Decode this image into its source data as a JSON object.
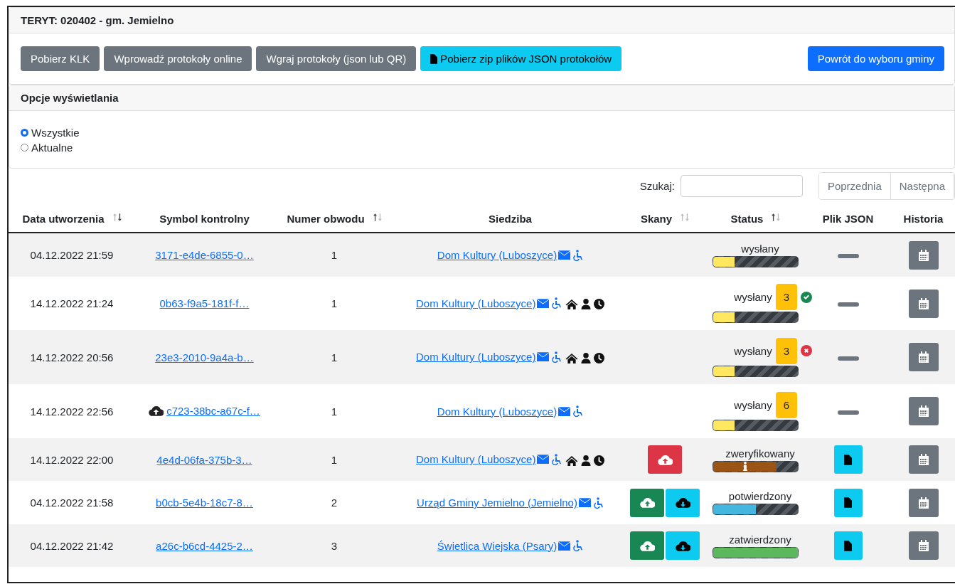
{
  "header": {
    "title": "TERYT: 020402 - gm. Jemielno"
  },
  "toolbar": {
    "buttons": [
      {
        "label": "Pobierz KLK",
        "kind": "secondary"
      },
      {
        "label": "Wprowadź protokoły online",
        "kind": "secondary"
      },
      {
        "label": "Wgraj protokoły (json lub QR)",
        "kind": "secondary"
      },
      {
        "label": "Pobierz zip plików JSON protokołów",
        "kind": "info"
      }
    ],
    "back_button": {
      "label": "Powrót do wyboru gminy"
    }
  },
  "display_options": {
    "title": "Opcje wyświetlania",
    "options": [
      {
        "label": "Wszystkie",
        "selected": true
      },
      {
        "label": "Aktualne",
        "selected": false
      }
    ]
  },
  "search": {
    "label": "Szukaj:"
  },
  "pagination": [
    "Poprzednia",
    "Następna"
  ],
  "table": {
    "columns": [
      {
        "label": "Data utworzenia",
        "sortable": true,
        "sort_asc": false,
        "sort_desc": true
      },
      {
        "label": "Symbol kontrolny",
        "sortable": false
      },
      {
        "label": "Numer obwodu",
        "sortable": true,
        "sort_asc": true,
        "sort_desc": false
      },
      {
        "label": "Siedziba",
        "sortable": false
      },
      {
        "label": "Skany",
        "sortable": true,
        "sort_asc": false,
        "sort_desc": false
      },
      {
        "label": "Status",
        "sortable": true,
        "sort_asc": true,
        "sort_desc": false
      },
      {
        "label": "Plik JSON",
        "sortable": false
      },
      {
        "label": "Historia",
        "sortable": false
      }
    ],
    "rows": [
      {
        "created": "04.12.2022 21:59",
        "symbol": "3171-e4de-6855-0…",
        "symbol_cloud": false,
        "number": "1",
        "location": "Dom Kultury (Luboszyce)",
        "location_details": false,
        "scans": [],
        "status": "wysłany",
        "progress": {
          "level": 0.25,
          "color": "#ffe760"
        },
        "info": false,
        "json_file": false
      },
      {
        "created": "14.12.2022 21:24",
        "symbol": "0b63-f9a5-181f-f…",
        "symbol_cloud": false,
        "number": "1",
        "location": "Dom Kultury (Luboszyce)",
        "location_details": true,
        "scans": [],
        "status": "wysłany",
        "count": "3",
        "check_passed": true,
        "progress": {
          "level": 0.25,
          "color": "#ffe760"
        },
        "info": false,
        "json_file": false
      },
      {
        "created": "14.12.2022 20:56",
        "symbol": "23e3-2010-9a4a-b…",
        "symbol_cloud": false,
        "number": "1",
        "location": "Dom Kultury (Luboszyce)",
        "location_details": true,
        "scans": [],
        "status": "wysłany",
        "count": "3",
        "check_passed": false,
        "progress": {
          "level": 0.25,
          "color": "#ffe760"
        },
        "info": false,
        "json_file": false
      },
      {
        "created": "14.12.2022 22:56",
        "symbol": "c723-38bc-a67c-f…",
        "symbol_cloud": true,
        "number": "1",
        "location": "Dom Kultury (Luboszyce)",
        "location_details": false,
        "scans": [],
        "status": "wysłany",
        "count": "6",
        "progress": {
          "level": 0.25,
          "color": "#ffe760"
        },
        "info": false,
        "json_file": false
      },
      {
        "created": "14.12.2022 22:00",
        "symbol": "4e4d-06fa-375b-3…",
        "symbol_cloud": false,
        "number": "1",
        "location": "Dom Kultury (Luboszyce)",
        "location_details": true,
        "scans": [
          {
            "kind": "upload_error"
          }
        ],
        "status": "zweryfikowany",
        "progress": {
          "level": 0.75,
          "color": "#9a5516"
        },
        "info": true,
        "json_file": true
      },
      {
        "created": "04.12.2022 21:58",
        "symbol": "b0cb-5e4b-18c7-8…",
        "symbol_cloud": false,
        "number": "2",
        "location": "Urząd Gminy Jemielno (Jemielno)",
        "location_details": false,
        "scans": [
          {
            "kind": "upload"
          },
          {
            "kind": "download"
          }
        ],
        "status": "potwierdzony",
        "progress": {
          "level": 0.5,
          "color": "#45b6dd"
        },
        "info": false,
        "json_file": true
      },
      {
        "created": "04.12.2022 21:42",
        "symbol": "a26c-b6cd-4425-2…",
        "symbol_cloud": false,
        "number": "3",
        "location": "Świetlica Wiejska (Psary)",
        "location_details": false,
        "scans": [
          {
            "kind": "upload"
          },
          {
            "kind": "download"
          }
        ],
        "status": "zatwierdzony",
        "progress": {
          "level": 1,
          "color": "#5cb85c"
        },
        "info": false,
        "json_file": true
      }
    ]
  }
}
